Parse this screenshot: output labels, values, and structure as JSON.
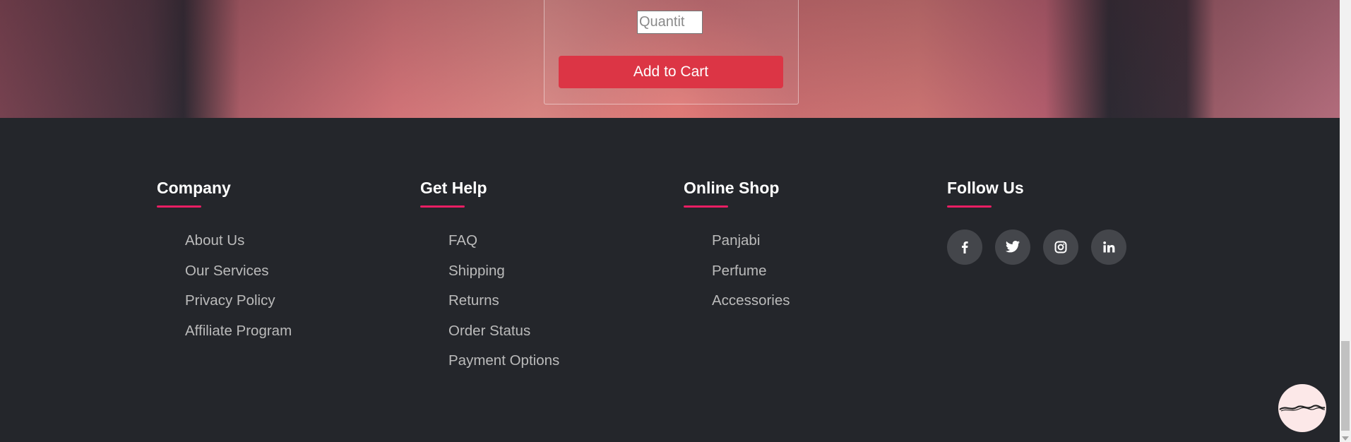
{
  "product": {
    "quantity_placeholder": "Quantit",
    "add_to_cart_label": "Add to Cart"
  },
  "footer": {
    "columns": [
      {
        "title": "Company",
        "links": [
          "About Us",
          "Our Services",
          "Privacy Policy",
          "Affiliate Program"
        ]
      },
      {
        "title": "Get Help",
        "links": [
          "FAQ",
          "Shipping",
          "Returns",
          "Order Status",
          "Payment Options"
        ]
      },
      {
        "title": "Online Shop",
        "links": [
          "Panjabi",
          "Perfume",
          "Accessories"
        ]
      },
      {
        "title": "Follow Us",
        "links": []
      }
    ],
    "social": [
      {
        "icon": "facebook-icon",
        "glyph": "f"
      },
      {
        "icon": "twitter-icon",
        "glyph": "twitter"
      },
      {
        "icon": "instagram-icon",
        "glyph": "instagram"
      },
      {
        "icon": "linkedin-icon",
        "glyph": "in"
      }
    ]
  },
  "colors": {
    "footer_bg": "#24262b",
    "accent_underline": "#e91e63",
    "cart_button": "#dc3545",
    "social_bg": "#44464b"
  }
}
